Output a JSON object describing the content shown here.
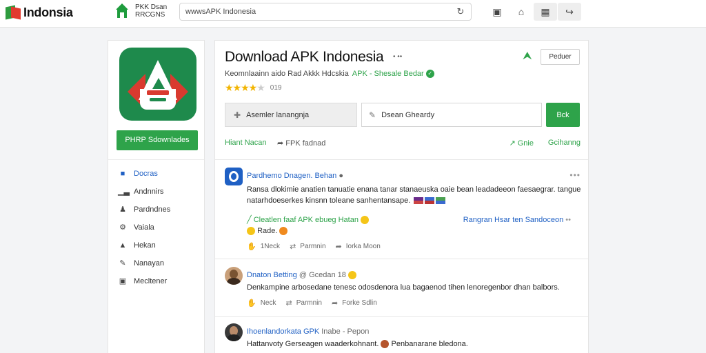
{
  "header": {
    "brand": "Indonsia",
    "apk_line1": "PKK Dsan",
    "apk_line2": "RRCGNS",
    "search_value": "wwwsAPK Indonesia",
    "icons": [
      "square-icon",
      "bell-icon",
      "grid-icon",
      "link-icon"
    ]
  },
  "sidebar": {
    "download_button": "PHRP Sdownlades",
    "items": [
      {
        "label": "Docras",
        "icon": "folder-icon",
        "active": true
      },
      {
        "label": "Andnnirs",
        "icon": "chart-icon",
        "active": false
      },
      {
        "label": "Pardndnes",
        "icon": "people-icon",
        "active": false
      },
      {
        "label": "Vaiala",
        "icon": "gear-icon",
        "active": false
      },
      {
        "label": "Hekan",
        "icon": "user-icon",
        "active": false
      },
      {
        "label": "Nanayan",
        "icon": "pen-icon",
        "active": false
      },
      {
        "label": "Mecltener",
        "icon": "monitor-icon",
        "active": false
      }
    ]
  },
  "main": {
    "title": "Download APK Indonesia",
    "title_dots": "• ••",
    "follow_button": "Peduer",
    "subtitle": "Keomnlaainn aido Rad Akkk Hdcskia",
    "subtitle_green": "APK - Shesale Bedar",
    "rating": {
      "stars": 4,
      "count": "019"
    },
    "field1": "Asemler lanangnja",
    "field2": "Dsean Gheardy",
    "go_button": "Bck",
    "actions": {
      "left1": "Hiant Nacan",
      "left2": "FPK fadnad",
      "right1": "Gnie",
      "right2": "Gcihanng"
    }
  },
  "posts": [
    {
      "name": "Pardhemo Dnagen. Behan",
      "line1": "Ransa dlokimie anatien tanuatie enana tanar stanaeuska oaie bean leadadeeon faesaegrar. tangue",
      "line2": "natarhdoeserkes kinsnn toleane sanhentansape.",
      "link": "Cleatlen faaf APK ebueg Hatan",
      "link_suffix": "Rade.",
      "link_right": "Rangran  Hsar ten Sandoceon",
      "like": "1Neck",
      "repost": "Parmnin",
      "share": "Iorka Moon"
    },
    {
      "name": "Dnaton Betting",
      "name_grey": "@ Gcedan",
      "name_num": "18",
      "line1": "Denkampine arbosedane tenesc odosdenora lua bagaenod tihen lenoregenbor dhan balbors.",
      "like": "Neck",
      "repost": "Parmnin",
      "share": "Forke Sdlin"
    },
    {
      "name": "Ihoenlandorkata GPK",
      "name_grey": "Inabe - Pepon",
      "line1": "Hattanvoty Gerseagen waaderkohnant.",
      "line1b": "Penbanarane bledona."
    }
  ]
}
